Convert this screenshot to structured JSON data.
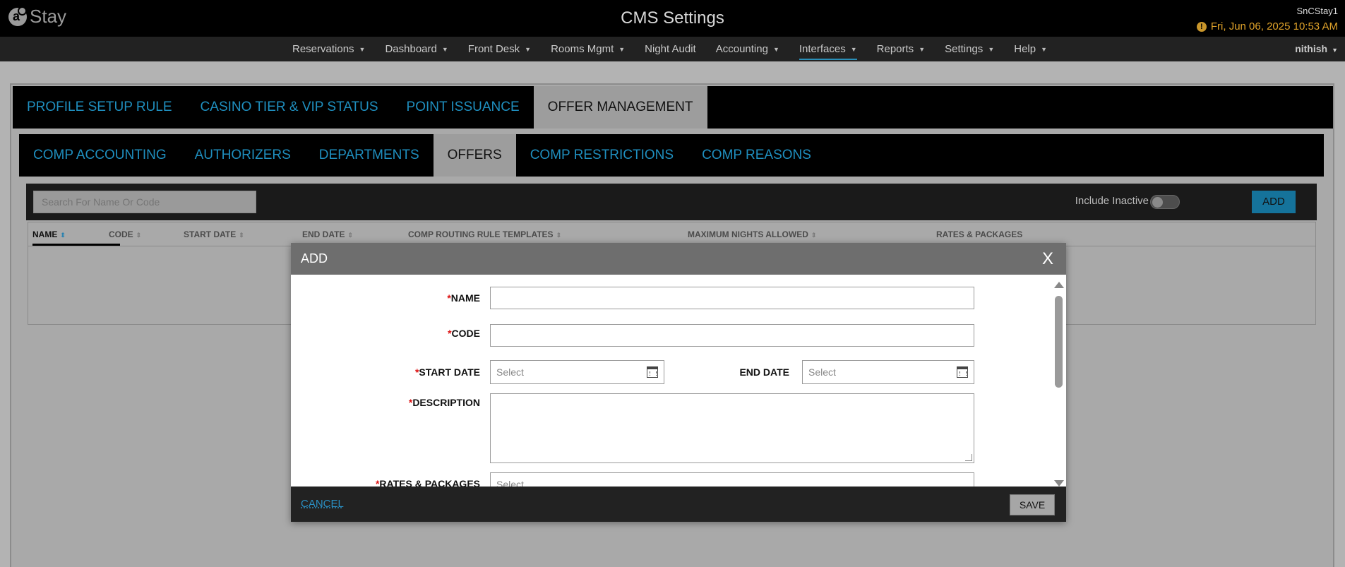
{
  "header": {
    "logo_text": "Stay",
    "app_title": "CMS Settings",
    "property": "SnCStay1",
    "datetime": "Fri, Jun 06, 2025 10:53 AM",
    "alert_icon": "alert-icon"
  },
  "nav": {
    "items": [
      {
        "label": "Reservations",
        "caret": true
      },
      {
        "label": "Dashboard",
        "caret": true
      },
      {
        "label": "Front Desk",
        "caret": true
      },
      {
        "label": "Rooms Mgmt",
        "caret": true
      },
      {
        "label": "Night Audit",
        "caret": false
      },
      {
        "label": "Accounting",
        "caret": true
      },
      {
        "label": "Interfaces",
        "caret": true
      },
      {
        "label": "Reports",
        "caret": true
      },
      {
        "label": "Settings",
        "caret": true
      },
      {
        "label": "Help",
        "caret": true
      }
    ],
    "active": "Interfaces",
    "user": "nithish"
  },
  "tabs_primary": [
    "PROFILE SETUP RULE",
    "CASINO TIER & VIP STATUS",
    "POINT ISSUANCE",
    "OFFER MANAGEMENT"
  ],
  "tabs_primary_active": "OFFER MANAGEMENT",
  "tabs_secondary": [
    "COMP ACCOUNTING",
    "AUTHORIZERS",
    "DEPARTMENTS",
    "OFFERS",
    "COMP RESTRICTIONS",
    "COMP REASONS"
  ],
  "tabs_secondary_active": "OFFERS",
  "toolbar": {
    "search_placeholder": "Search For Name Or Code",
    "include_inactive_label": "Include Inactive",
    "include_inactive": false,
    "add_label": "ADD"
  },
  "grid": {
    "columns": [
      "NAME",
      "CODE",
      "START DATE",
      "END DATE",
      "COMP ROUTING RULE TEMPLATES",
      "MAXIMUM NIGHTS ALLOWED",
      "RATES & PACKAGES"
    ],
    "sorted_column": "NAME"
  },
  "modal": {
    "title": "ADD",
    "close_label": "X",
    "fields": {
      "name_label": "NAME",
      "code_label": "CODE",
      "start_date_label": "START DATE",
      "start_date_placeholder": "Select",
      "end_date_label": "END DATE",
      "end_date_placeholder": "Select",
      "description_label": "DESCRIPTION",
      "rates_label": "RATES & PACKAGES",
      "rates_placeholder": "Select"
    },
    "required_mark": "*",
    "cancel_label": "CANCEL",
    "save_label": "SAVE"
  },
  "colors": {
    "accent": "#1f8fbf",
    "datetime": "#e0a32a",
    "required": "#dd1111"
  }
}
